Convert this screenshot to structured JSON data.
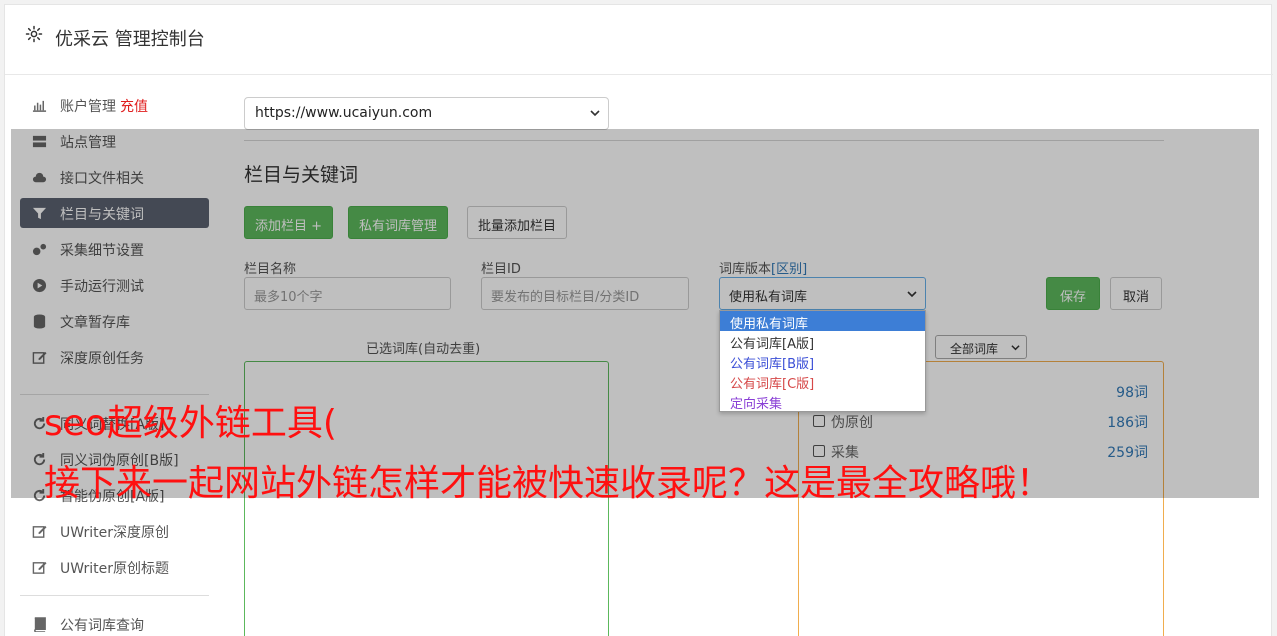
{
  "header": {
    "title": "优采云 管理控制台",
    "icon": "gear-icon"
  },
  "sidebar": {
    "items": [
      {
        "label": "账户管理",
        "badge": "充值",
        "icon": "bar-chart-icon"
      },
      {
        "label": "站点管理",
        "icon": "server-icon"
      },
      {
        "label": "接口文件相关",
        "icon": "cloud-upload-icon"
      },
      {
        "label": "栏目与关键词",
        "icon": "filter-icon",
        "active": true
      },
      {
        "label": "采集细节设置",
        "icon": "gears-icon"
      },
      {
        "label": "手动运行测试",
        "icon": "play-circle-icon"
      },
      {
        "label": "文章暂存库",
        "icon": "database-icon"
      },
      {
        "label": "深度原创任务",
        "icon": "edit-icon"
      },
      {
        "label": "同义词替换[A版]",
        "icon": "refresh-icon"
      },
      {
        "label": "同义词伪原创[B版]",
        "icon": "refresh-icon"
      },
      {
        "label": "智能伪原创[A版]",
        "icon": "refresh-icon"
      },
      {
        "label": "UWriter深度原创",
        "icon": "edit-icon"
      },
      {
        "label": "UWriter原创标题",
        "icon": "edit-icon"
      },
      {
        "label": "公有词库查询",
        "icon": "book-icon"
      }
    ]
  },
  "site_select": {
    "value": "https://www.ucaiyun.com"
  },
  "section": {
    "title": "栏目与关键词"
  },
  "buttons": {
    "add_column": "添加栏目 +",
    "private_lib": "私有词库管理",
    "batch_add": "批量添加栏目",
    "save": "保存",
    "cancel": "取消"
  },
  "form": {
    "name_label": "栏目名称",
    "name_placeholder": "最多10个字",
    "id_label": "栏目ID",
    "id_placeholder": "要发布的目标栏目/分类ID",
    "version_label": "词库版本",
    "version_link": "[区别]",
    "version_value": "使用私有词库"
  },
  "version_options": [
    {
      "label": "使用私有词库",
      "color": "#ffffff",
      "selected": true
    },
    {
      "label": "公有词库[A版]",
      "color": "#333333"
    },
    {
      "label": "公有词库[B版]",
      "color": "#3b4fd6"
    },
    {
      "label": "公有词库[C版]",
      "color": "#d64848"
    },
    {
      "label": "定向采集",
      "color": "#8a3fd6"
    }
  ],
  "selected_libs": {
    "title": "已选词库(自动去重)"
  },
  "filter_select": {
    "value": "全部词库"
  },
  "libraries": [
    {
      "name": "",
      "count": "98词"
    },
    {
      "name": "伪原创",
      "count": "186词"
    },
    {
      "name": "采集",
      "count": "259词"
    }
  ],
  "caption": {
    "line1": "seo超级外链工具(",
    "line2": "接下来一起网站外链怎样才能被快速收录呢？这是最全攻略哦！"
  }
}
